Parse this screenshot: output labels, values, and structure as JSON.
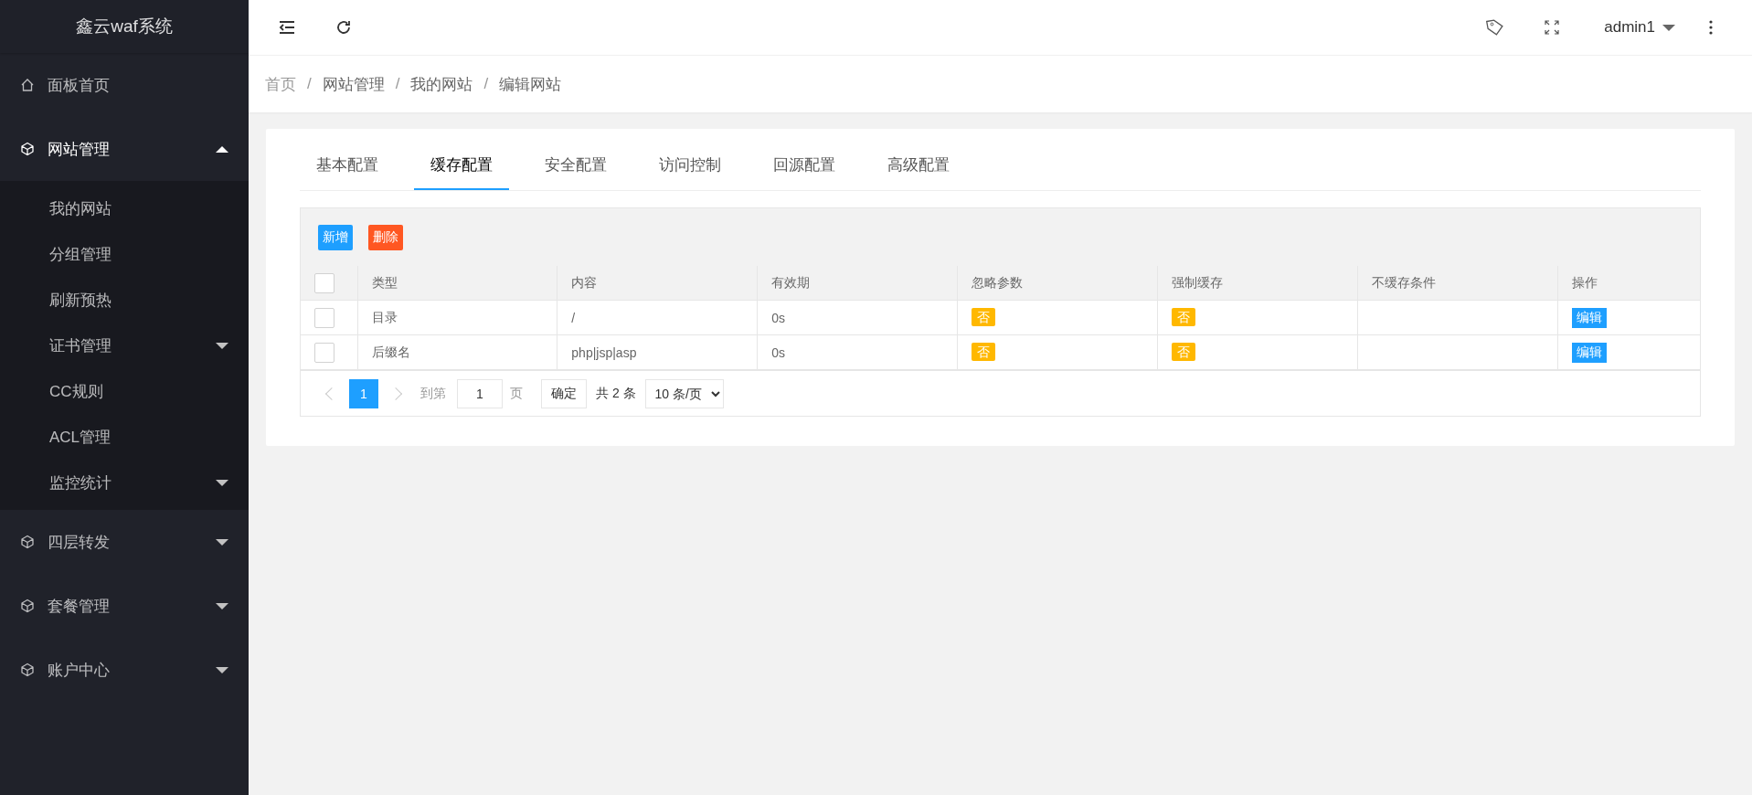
{
  "sidebar": {
    "logo": "鑫云waf系统",
    "items": [
      {
        "label": "面板首页",
        "kind": "home"
      },
      {
        "label": "网站管理",
        "kind": "group",
        "expanded": true,
        "children": [
          {
            "label": "我的网站"
          },
          {
            "label": "分组管理"
          },
          {
            "label": "刷新预热"
          },
          {
            "label": "证书管理",
            "expanded": false
          },
          {
            "label": "CC规则"
          },
          {
            "label": "ACL管理"
          },
          {
            "label": "监控统计",
            "expanded": false
          }
        ]
      },
      {
        "label": "四层转发",
        "kind": "group",
        "expanded": false
      },
      {
        "label": "套餐管理",
        "kind": "group",
        "expanded": false
      },
      {
        "label": "账户中心",
        "kind": "group",
        "expanded": false
      }
    ]
  },
  "topbar": {
    "user": "admin1"
  },
  "breadcrumb": {
    "separator": "/",
    "items": [
      "首页",
      "网站管理",
      "我的网站",
      "编辑网站"
    ]
  },
  "tabs": [
    {
      "label": "基本配置",
      "selected": false
    },
    {
      "label": "缓存配置",
      "selected": true
    },
    {
      "label": "安全配置",
      "selected": false
    },
    {
      "label": "访问控制",
      "selected": false
    },
    {
      "label": "回源配置",
      "selected": false
    },
    {
      "label": "高级配置",
      "selected": false
    }
  ],
  "toolbar": {
    "add": "新增",
    "delete": "删除"
  },
  "table": {
    "header_checked": false,
    "columns": [
      "类型",
      "内容",
      "有效期",
      "忽略参数",
      "强制缓存",
      "不缓存条件",
      "操作"
    ],
    "rows": [
      {
        "checked": false,
        "type": "目录",
        "content": "/",
        "expiry": "0s",
        "ignore_params": "否",
        "force_cache": "否",
        "action": "编辑"
      },
      {
        "checked": false,
        "type": "后缀名",
        "content": "php|jsp|asp",
        "expiry": "0s",
        "ignore_params": "否",
        "force_cache": "否",
        "action": "编辑"
      }
    ]
  },
  "pagination": {
    "pages": [
      {
        "label": "1",
        "selected": true
      }
    ],
    "goto_label": "到第",
    "goto_value": "1",
    "page_suffix": "页",
    "confirm": "确定",
    "total": "共 2 条",
    "page_size": "10 条/页"
  }
}
